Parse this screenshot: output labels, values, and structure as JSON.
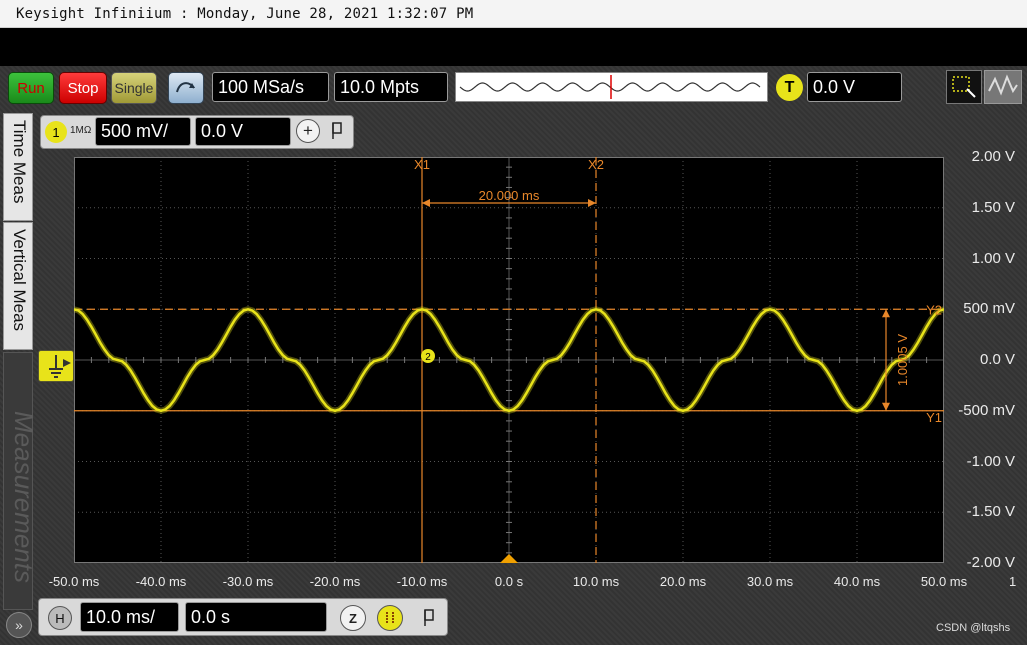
{
  "window": {
    "title": "Keysight Infiniium : Monday, June 28, 2021 1:32:07 PM"
  },
  "toolbar": {
    "run_label": "Run",
    "stop_label": "Stop",
    "single_label": "Single",
    "sample_rate": "100 MSa/s",
    "memory_depth": "10.0 Mpts",
    "trigger_badge": "T",
    "trigger_level": "0.0 V"
  },
  "side_tabs": {
    "time_meas": "Time Meas",
    "vertical_meas": "Vertical Meas",
    "measurements": "Measurements",
    "expand_label": "»"
  },
  "channel": {
    "number": "1",
    "impedance": "1MΩ",
    "scale": "500 mV/",
    "offset": "0.0 V",
    "add_label": "+"
  },
  "horizontal": {
    "badge": "H",
    "scale": "10.0 ms/",
    "position": "0.0 s",
    "zoom_badge": "Z"
  },
  "watermark": "CSDN @ltqshs",
  "colors": {
    "trace": "#e8e31a",
    "cursor": "#e8872a",
    "run": "#1fa81f",
    "stop": "#e01010"
  },
  "chart_data": {
    "type": "line",
    "x_ticks": [
      "-50.0 ms",
      "-40.0 ms",
      "-30.0 ms",
      "-20.0 ms",
      "-10.0 ms",
      "0.0 s",
      "10.0 ms",
      "20.0 ms",
      "30.0 ms",
      "40.0 ms",
      "50.0 ms"
    ],
    "y_ticks": [
      "2.00 V",
      "1.50 V",
      "1.00 V",
      "500 mV",
      "0.0 V",
      "-500 mV",
      "-1.00 V",
      "-1.50 V",
      "-2.00 V"
    ],
    "xlim": [
      -50,
      50
    ],
    "ylim": [
      -2.0,
      2.0
    ],
    "x_unit": "ms",
    "y_unit": "V",
    "channel_indicator": "1",
    "series": [
      {
        "x": [
          -50,
          -45,
          -40,
          -35,
          -30,
          -25,
          -20,
          -15,
          -10,
          -5,
          0,
          5,
          10,
          15,
          20,
          25,
          30,
          35,
          40,
          45,
          50
        ],
        "values": [
          0.5,
          0,
          -0.5,
          0,
          0.5,
          0,
          -0.5,
          0,
          0.5,
          0,
          -0.5,
          0,
          0.5,
          0,
          -0.5,
          0,
          0.5,
          0,
          -0.5,
          0,
          0.5
        ]
      }
    ],
    "cursors": {
      "x1_label": "X1",
      "x2_label": "X2",
      "x1": -10,
      "x2": 10,
      "delta_x": "20.000 ms",
      "y1_label": "Y1",
      "y2_label": "Y2",
      "y1": -0.5,
      "y2": 0.5,
      "delta_y": "1.0005 V",
      "marker_2": "2"
    },
    "grid": true
  }
}
